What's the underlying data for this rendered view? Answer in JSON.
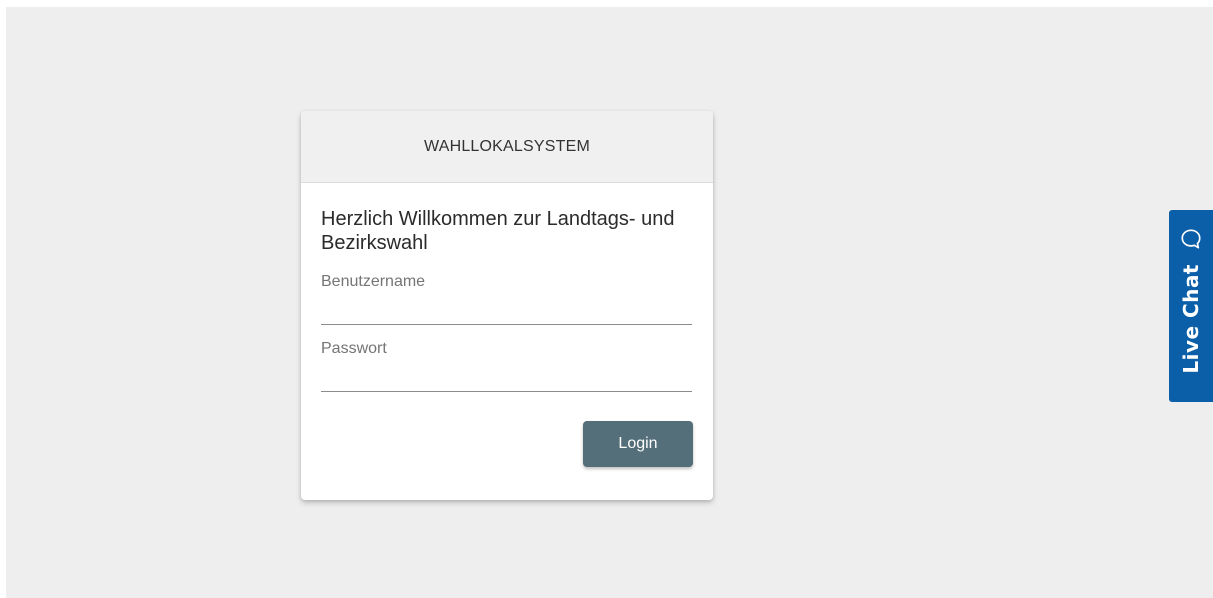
{
  "card": {
    "header": "WAHLLOKALSYSTEM",
    "welcome": "Herzlich Willkommen zur Landtags- und Bezirkswahl",
    "username": {
      "label": "Benutzername",
      "value": ""
    },
    "password": {
      "label": "Passwort",
      "value": ""
    },
    "login_label": "Login"
  },
  "live_chat": {
    "label": "Live Chat",
    "icon": "chat-bubble-icon"
  },
  "colors": {
    "background": "#eeeeee",
    "button": "#546e7a",
    "live_chat": "#0b5ea8"
  }
}
